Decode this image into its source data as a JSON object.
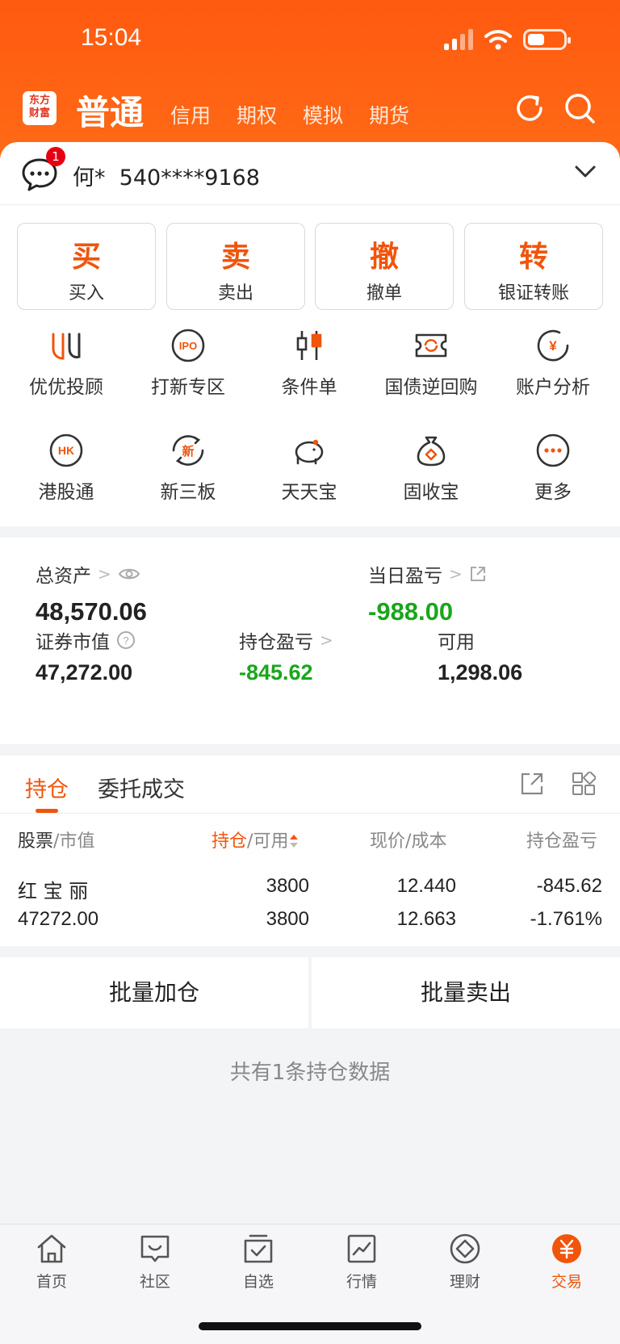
{
  "status_bar": {
    "time": "15:04"
  },
  "header": {
    "logo_text": "东方\n财富",
    "tabs": [
      {
        "label": "普通",
        "active": true
      },
      {
        "label": "信用"
      },
      {
        "label": "期权"
      },
      {
        "label": "模拟"
      },
      {
        "label": "期货"
      }
    ],
    "icons": [
      "refresh-icon",
      "search-icon"
    ]
  },
  "account": {
    "badge": "1",
    "name": "何*  540****9168"
  },
  "actions": [
    {
      "big": "买",
      "small": "买入"
    },
    {
      "big": "卖",
      "small": "卖出"
    },
    {
      "big": "撤",
      "small": "撤单"
    },
    {
      "big": "转",
      "small": "银证转账"
    }
  ],
  "grid": [
    {
      "label": "优优投顾",
      "icon": "uu-icon"
    },
    {
      "label": "打新专区",
      "icon": "ipo-icon",
      "icon_text": "IPO"
    },
    {
      "label": "条件单",
      "icon": "candlestick-icon"
    },
    {
      "label": "国债逆回购",
      "icon": "repo-icon"
    },
    {
      "label": "账户分析",
      "icon": "account-analysis-icon",
      "icon_text": "¥"
    },
    {
      "label": "港股通",
      "icon": "hk-icon",
      "icon_text": "HK"
    },
    {
      "label": "新三板",
      "icon": "new-board-icon",
      "icon_text": "新"
    },
    {
      "label": "天天宝",
      "icon": "piggy-bank-icon"
    },
    {
      "label": "固收宝",
      "icon": "money-bag-icon"
    },
    {
      "label": "更多",
      "icon": "more-icon"
    }
  ],
  "assets": {
    "total_label": "总资产",
    "total_value": "48,570.06",
    "daily_label": "当日盈亏",
    "daily_value": "-988.00",
    "market_label": "证券市值",
    "market_value": "47,272.00",
    "position_pl_label": "持仓盈亏",
    "position_pl_value": "-845.62",
    "available_label": "可用",
    "available_value": "1,298.06"
  },
  "positions": {
    "tabs": [
      "持仓",
      "委托成交"
    ],
    "headers": {
      "stock": "股票",
      "market_value": "市值",
      "holding": "持仓",
      "available": "可用",
      "price": "现价",
      "cost": "成本",
      "pl": "持仓盈亏"
    },
    "rows": [
      {
        "name": "红 宝 丽",
        "value": "47272.00",
        "holding": "3800",
        "available": "3800",
        "price": "12.440",
        "cost": "12.663",
        "pl": "-845.62",
        "pl_pct": "-1.761%"
      }
    ]
  },
  "batch": {
    "add": "批量加仓",
    "sell": "批量卖出"
  },
  "summary": "共有1条持仓数据",
  "colors": {
    "brand": "#ff5a10",
    "accent": "#f0550c",
    "loss": "#1aa61a"
  },
  "tabbar": [
    {
      "label": "首页",
      "icon": "home-icon"
    },
    {
      "label": "社区",
      "icon": "community-icon"
    },
    {
      "label": "自选",
      "icon": "watchlist-icon"
    },
    {
      "label": "行情",
      "icon": "market-icon"
    },
    {
      "label": "理财",
      "icon": "wealth-icon"
    },
    {
      "label": "交易",
      "icon": "trade-icon",
      "active": true
    }
  ]
}
